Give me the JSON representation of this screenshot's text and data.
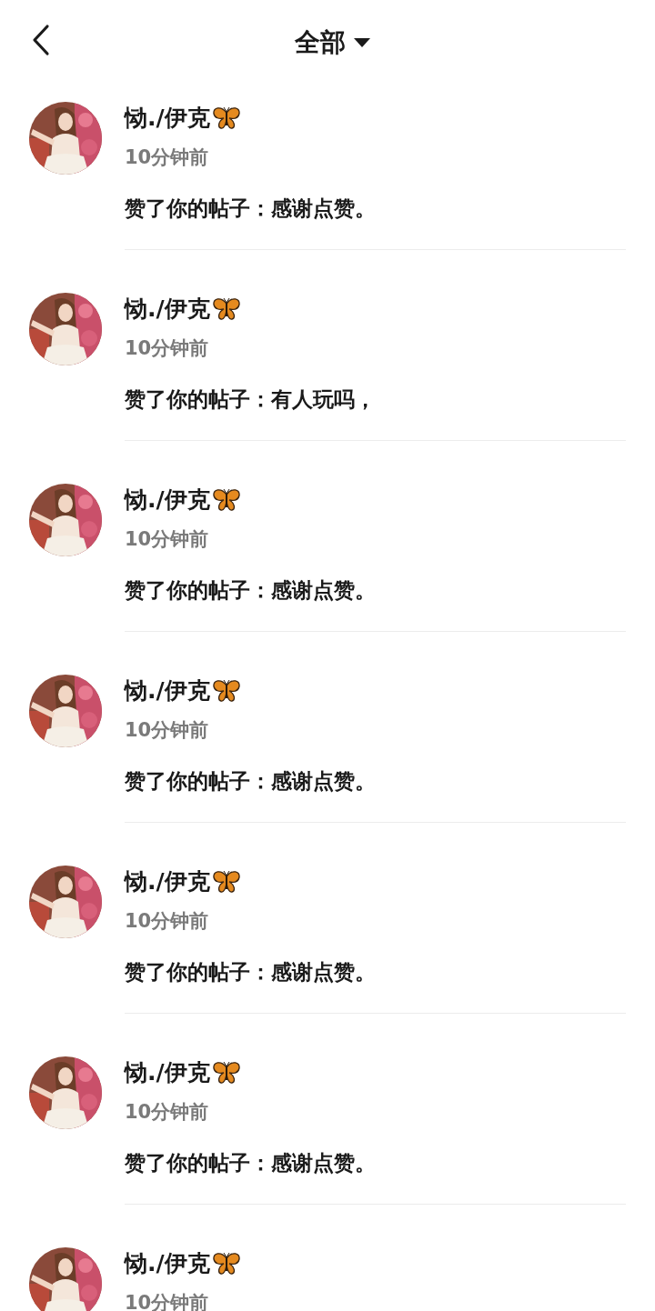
{
  "header": {
    "title": "全部"
  },
  "notifications": [
    {
      "name": "恸./伊克",
      "time": "10分钟前",
      "message": "赞了你的帖子：感谢点赞。"
    },
    {
      "name": "恸./伊克",
      "time": "10分钟前",
      "message": "赞了你的帖子：有人玩吗，"
    },
    {
      "name": "恸./伊克",
      "time": "10分钟前",
      "message": "赞了你的帖子：感谢点赞。"
    },
    {
      "name": "恸./伊克",
      "time": "10分钟前",
      "message": "赞了你的帖子：感谢点赞。"
    },
    {
      "name": "恸./伊克",
      "time": "10分钟前",
      "message": "赞了你的帖子：感谢点赞。"
    },
    {
      "name": "恸./伊克",
      "time": "10分钟前",
      "message": "赞了你的帖子：感谢点赞。"
    },
    {
      "name": "恸./伊克",
      "time": "10分钟前"
    }
  ]
}
